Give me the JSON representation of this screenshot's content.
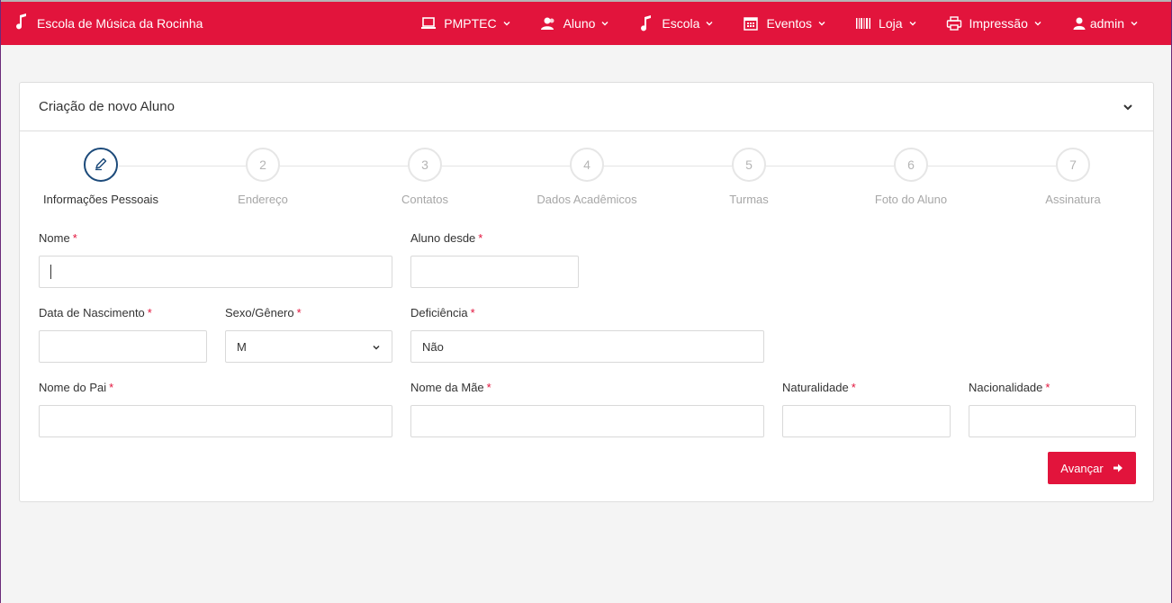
{
  "brand": {
    "name": "Escola de Música da Rocinha",
    "icon": "music-note-icon"
  },
  "nav": {
    "items": [
      {
        "label": "PMPTEC",
        "icon": "laptop-icon"
      },
      {
        "label": "Aluno",
        "icon": "users-icon"
      },
      {
        "label": "Escola",
        "icon": "music-note-icon"
      },
      {
        "label": "Eventos",
        "icon": "calendar-icon"
      },
      {
        "label": "Loja",
        "icon": "barcode-icon"
      },
      {
        "label": "Impressão",
        "icon": "printer-icon"
      },
      {
        "label": "admin",
        "icon": "user-icon"
      }
    ]
  },
  "card": {
    "title": "Criação de novo Aluno"
  },
  "stepper": {
    "steps": [
      {
        "number": "",
        "label": "Informações Pessoais",
        "icon": "pencil-icon"
      },
      {
        "number": "2",
        "label": "Endereço"
      },
      {
        "number": "3",
        "label": "Contatos"
      },
      {
        "number": "4",
        "label": "Dados Acadêmicos"
      },
      {
        "number": "5",
        "label": "Turmas"
      },
      {
        "number": "6",
        "label": "Foto do Aluno"
      },
      {
        "number": "7",
        "label": "Assinatura"
      }
    ]
  },
  "form": {
    "nome": {
      "label": "Nome",
      "value": ""
    },
    "aluno_desde": {
      "label": "Aluno desde",
      "value": ""
    },
    "data_nascimento": {
      "label": "Data de Nascimento",
      "value": ""
    },
    "sexo": {
      "label": "Sexo/Gênero",
      "value": "M"
    },
    "deficiencia": {
      "label": "Deficiência",
      "value": "Não"
    },
    "nome_pai": {
      "label": "Nome do Pai",
      "value": ""
    },
    "nome_mae": {
      "label": "Nome da Mãe",
      "value": ""
    },
    "naturalidade": {
      "label": "Naturalidade",
      "value": ""
    },
    "nacionalidade": {
      "label": "Nacionalidade",
      "value": ""
    },
    "required_mark": "*",
    "submit_label": "Avançar"
  },
  "colors": {
    "accent": "#e2143c",
    "active_step": "#1c4a7a"
  }
}
